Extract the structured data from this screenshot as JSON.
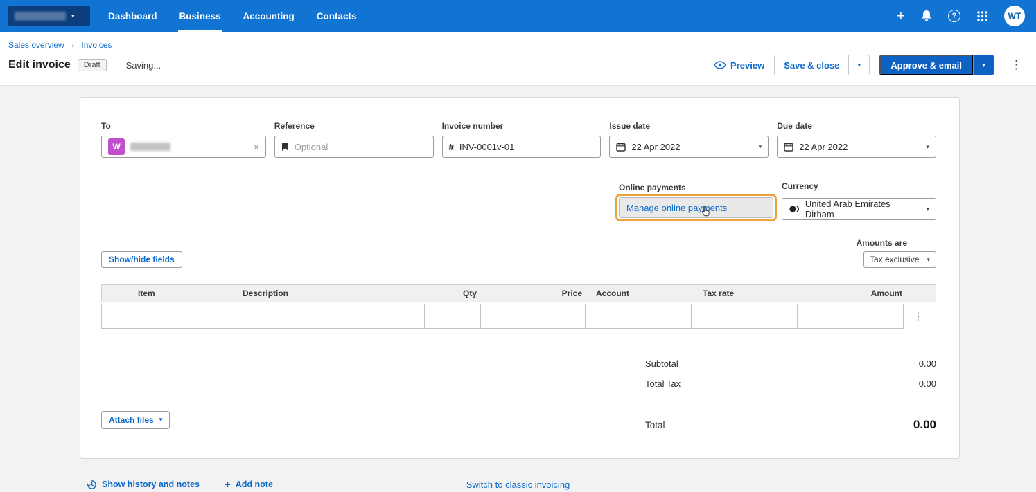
{
  "icons": {
    "plus": "+",
    "question": "?",
    "kebab": "⋮",
    "close": "×",
    "caret": "▾",
    "crumb_sep": "›"
  },
  "colors": {
    "nav_blue": "#1173d2",
    "accent_blue": "#0d6acd",
    "approve_blue": "#0e62c4",
    "highlight_orange": "#eba43c",
    "chip_magenta": "#c14fc9"
  },
  "nav": {
    "items": [
      {
        "label": "Dashboard",
        "active": false
      },
      {
        "label": "Business",
        "active": true
      },
      {
        "label": "Accounting",
        "active": false
      },
      {
        "label": "Contacts",
        "active": false
      }
    ],
    "avatar_initials": "WT"
  },
  "header": {
    "breadcrumbs": [
      "Sales overview",
      "Invoices"
    ],
    "title": "Edit invoice",
    "status_badge": "Draft",
    "saving_text": "Saving...",
    "preview_label": "Preview",
    "save_close_label": "Save & close",
    "approve_email_label": "Approve & email"
  },
  "form": {
    "to": {
      "label": "To",
      "chip_initial": "W"
    },
    "reference": {
      "label": "Reference",
      "placeholder": "Optional"
    },
    "invoice_number": {
      "label": "Invoice number",
      "prefix": "#",
      "value": "INV-0001v-01"
    },
    "issue_date": {
      "label": "Issue date",
      "value": "22 Apr 2022"
    },
    "due_date": {
      "label": "Due date",
      "value": "22 Apr 2022"
    },
    "online_payments": {
      "label": "Online payments",
      "button_label": "Manage online payments"
    },
    "currency": {
      "label": "Currency",
      "value": "United Arab Emirates Dirham"
    },
    "amounts_are": {
      "label": "Amounts are",
      "value": "Tax exclusive"
    },
    "show_hide_fields_label": "Show/hide fields"
  },
  "table": {
    "headers": [
      "Item",
      "Description",
      "Qty",
      "Price",
      "Account",
      "Tax rate",
      "Amount"
    ]
  },
  "totals": {
    "subtotal_label": "Subtotal",
    "subtotal_value": "0.00",
    "total_tax_label": "Total Tax",
    "total_tax_value": "0.00",
    "total_label": "Total",
    "total_value": "0.00"
  },
  "footer": {
    "attach_files_label": "Attach files",
    "show_history_label": "Show history and notes",
    "add_note_label": "Add note",
    "switch_classic_label": "Switch to classic invoicing"
  }
}
